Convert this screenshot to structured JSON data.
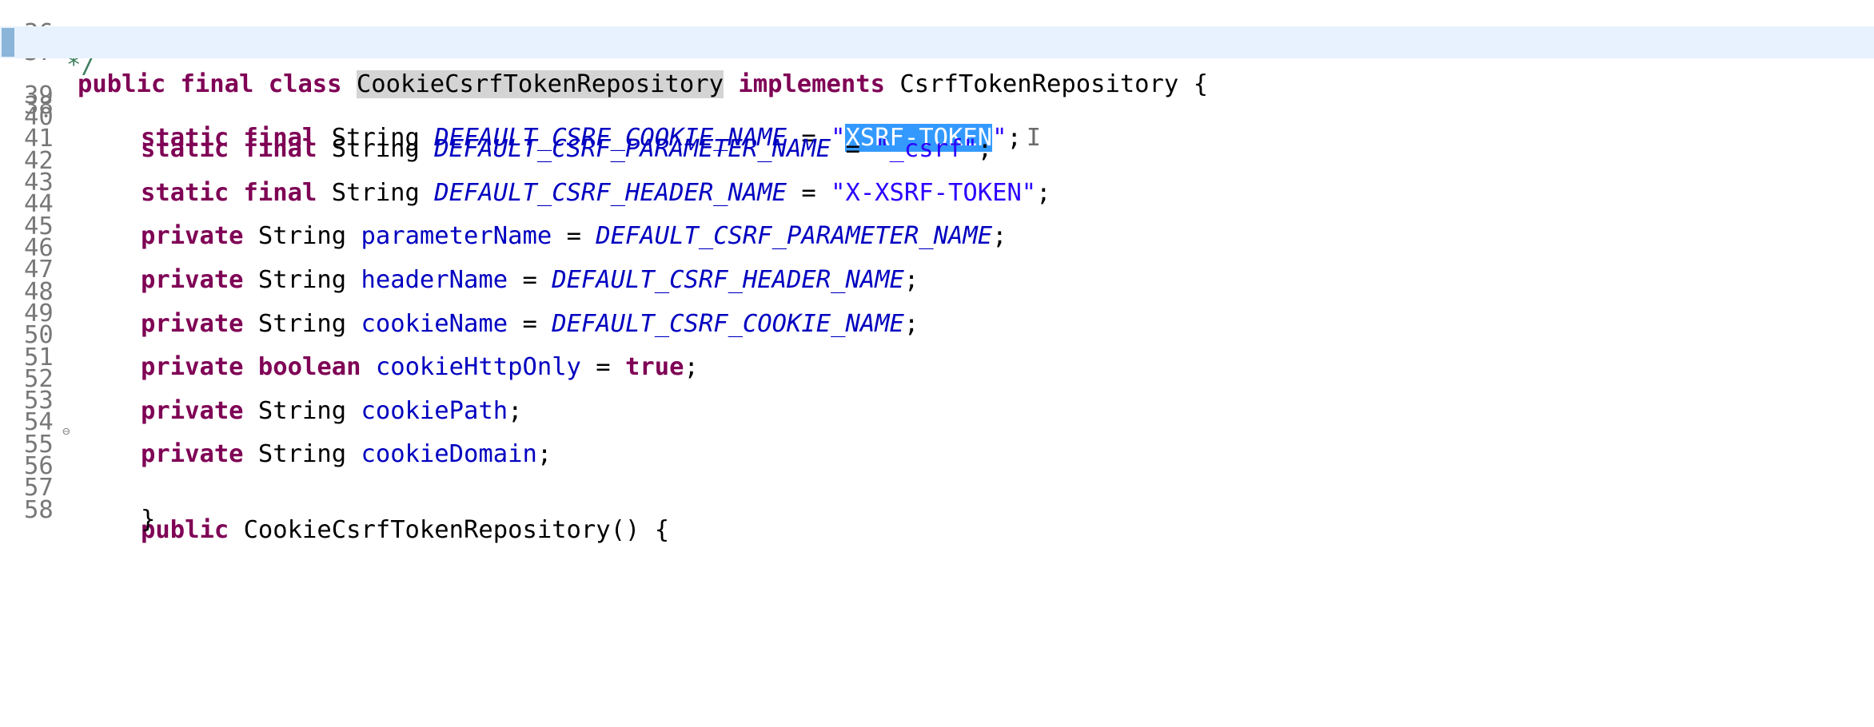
{
  "editor": {
    "lines": [
      {
        "num": "36",
        "code": "*/"
      },
      {
        "num": "37",
        "kw1": "public final class",
        "cls": "CookieCsrfTokenRepository",
        "kw2": "implements",
        "iface": "CsrfTokenRepository {"
      },
      {
        "num": "38",
        "mods": "static final",
        "type": "String",
        "name": "DEFAULT_CSRF_COOKIE_NAME",
        "eq": " = ",
        "q1": "\"",
        "sel": "XSRF-TOKEN",
        "q2": "\"",
        "semi": ";",
        "cursor": "I"
      },
      {
        "num": "39"
      },
      {
        "num": "40",
        "mods": "static final",
        "type": "String",
        "name": "DEFAULT_CSRF_PARAMETER_NAME",
        "eq": " = ",
        "val": "\"_csrf\"",
        "semi": ";"
      },
      {
        "num": "41"
      },
      {
        "num": "42",
        "mods": "static final",
        "type": "String",
        "name": "DEFAULT_CSRF_HEADER_NAME",
        "eq": " = ",
        "val": "\"X-XSRF-TOKEN\"",
        "semi": ";"
      },
      {
        "num": "43"
      },
      {
        "num": "44",
        "mods": "private",
        "type": "String",
        "name": "parameterName",
        "eq": " = ",
        "val": "DEFAULT_CSRF_PARAMETER_NAME",
        "semi": ";"
      },
      {
        "num": "45"
      },
      {
        "num": "46",
        "mods": "private",
        "type": "String",
        "name": "headerName",
        "eq": " = ",
        "val": "DEFAULT_CSRF_HEADER_NAME",
        "semi": ";"
      },
      {
        "num": "47"
      },
      {
        "num": "48",
        "mods": "private",
        "type": "String",
        "name": "cookieName",
        "eq": " = ",
        "val": "DEFAULT_CSRF_COOKIE_NAME",
        "semi": ";"
      },
      {
        "num": "49"
      },
      {
        "num": "50",
        "mods": "private",
        "type": "boolean",
        "name": "cookieHttpOnly",
        "eq": " = ",
        "val": "true",
        "semi": ";"
      },
      {
        "num": "51"
      },
      {
        "num": "52",
        "mods": "private",
        "type": "String",
        "name": "cookiePath",
        "semi": ";"
      },
      {
        "num": "53"
      },
      {
        "num": "54",
        "mods": "private",
        "type": "String",
        "name": "cookieDomain",
        "semi": ";"
      },
      {
        "num": "55"
      },
      {
        "num": "56",
        "fold": "⊖",
        "mods": "public",
        "ctor": "CookieCsrfTokenRepository() {"
      },
      {
        "num": "57",
        "code": "}"
      },
      {
        "num": "58"
      }
    ]
  },
  "colors": {
    "keyword": "#7f0055",
    "constant": "#0000c0",
    "string": "#2a00ff",
    "selection": "#3399ff",
    "current_line": "#e8f2fe",
    "line_number": "#787878"
  }
}
